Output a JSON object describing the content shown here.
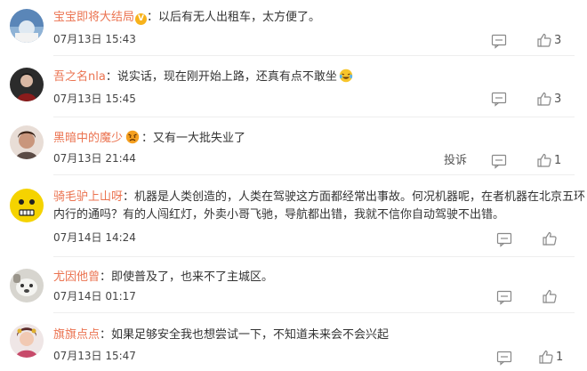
{
  "comments": [
    {
      "username": "宝宝即将大结局",
      "verified": true,
      "separator": "：",
      "text": "以后有无人出租车，太方便了。",
      "time": "07月13日 15:43",
      "like_count": "3"
    },
    {
      "username": "吾之名nla",
      "separator": "：",
      "text": "说实话，现在刚开始上路，还真有点不敢坐",
      "emoji": "laughing-crying-face",
      "time": "07月13日 15:45",
      "like_count": "3"
    },
    {
      "username": "黑暗中的魔少",
      "emoji_after_name": "angry-face",
      "separator": "：",
      "text": "又有一大批失业了",
      "time": "07月13日 21:44",
      "report_label": "投诉",
      "like_count": "1"
    },
    {
      "username": "骑毛驴上山呀",
      "separator": "：",
      "text": "机器是人类创造的，人类在驾驶这方面都经常出事故。何况机器呢，在者机器在北京五环",
      "text_line2": "内行的通吗？有的人闯红灯，外卖小哥飞驰，导航都出错，我就不信你自动驾驶不出错。",
      "time": "07月14日 14:24",
      "like_count": ""
    },
    {
      "username": "尤因他曾",
      "separator": "：",
      "text": "即使普及了，也来不了主城区。",
      "time": "07月14日 01:17",
      "like_count": ""
    },
    {
      "username": "旗旗点点",
      "separator": "：",
      "text": "如果足够安全我也想尝试一下，不知道未来会不会兴起",
      "time": "07月13日 15:47",
      "like_count": "1"
    }
  ],
  "icons": {
    "reply": "comment-icon",
    "like": "thumbs-up-icon",
    "verified": "verified-badge-icon"
  },
  "colors": {
    "username": "#eb7350",
    "text": "#333333",
    "meta": "#444444",
    "icon": "#888888",
    "badge": "#f7b21b"
  }
}
